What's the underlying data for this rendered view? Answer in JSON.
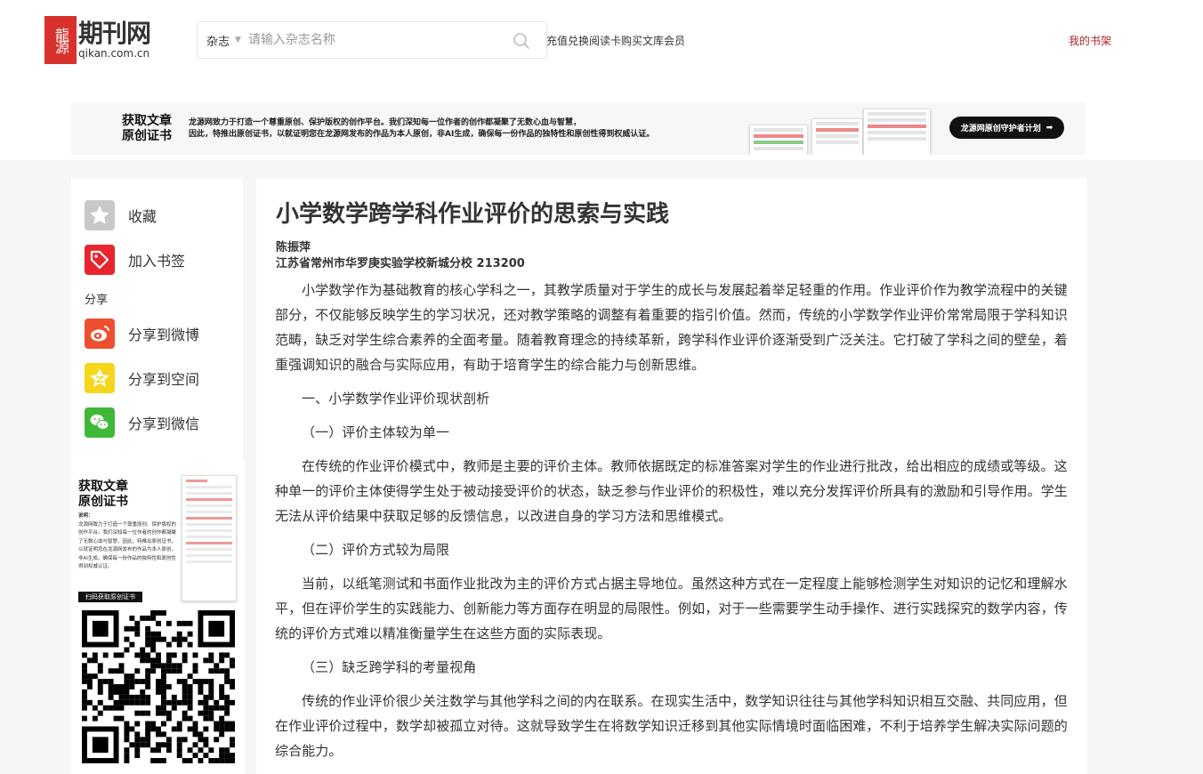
{
  "header": {
    "logo_cn": "期刊网",
    "logo_en": "qikan.com.cn",
    "logo_mark": "龍源",
    "search_type": "杂志",
    "search_placeholder": "请输入杂志名称",
    "top_link": "充值兑换阅读卡购买文库会员",
    "bookshelf": "我的书架"
  },
  "banner": {
    "title_line1": "获取文章",
    "title_line2": "原创证书",
    "desc_line1": "龙源网致力于打造一个尊重原创、保护版权的创作平台。我们深知每一位作者的创作都凝聚了无数心血与智慧，",
    "desc_line2": "因此，特推出原创证书，以就证明您在龙源网发布的作品为本人原创，非AI生成，确保每一份作品的独特性和原创性得到权威认证。",
    "button": "龙源网原创守护者计划"
  },
  "sidebar": {
    "favorite": "收藏",
    "bookmark": "加入书签",
    "share_title": "分享",
    "share_weibo": "分享到微博",
    "share_qzone": "分享到空间",
    "share_wechat": "分享到微信",
    "promo_title_line1": "获取文章",
    "promo_title_line2": "原创证书",
    "promo_desc_label": "说明：",
    "promo_desc": "龙源网致力于打造一个尊重原创、保护版权的创作平台。我们深知每一位作者的创作都凝聚了无数心血与智慧，因此，特推出原创证书，以就证明您在龙源网发布的作品为本人原创，非AI生成，确保每一份作品的独特性和原创性得到权威认证。",
    "promo_cta": "扫码获取原创证书"
  },
  "article": {
    "title": "小学数学跨学科作业评价的思索与实践",
    "author": "陈振萍",
    "org": "江苏省常州市华罗庚实验学校新城分校 213200",
    "paragraphs": [
      "小学数学作为基础教育的核心学科之一，其教学质量对于学生的成长与发展起着举足轻重的作用。作业评价作为教学流程中的关键部分，不仅能够反映学生的学习状况，还对教学策略的调整有着重要的指引价值。然而，传统的小学数学作业评价常常局限于学科知识范畴，缺乏对学生综合素养的全面考量。随着教育理念的持续革新，跨学科作业评价逐渐受到广泛关注。它打破了学科之间的壁垒，着重强调知识的融合与实际应用，有助于培育学生的综合能力与创新思维。",
      "一、小学数学作业评价现状剖析",
      "（一）评价主体较为单一",
      "在传统的作业评价模式中，教师是主要的评价主体。教师依据既定的标准答案对学生的作业进行批改，给出相应的成绩或等级。这种单一的评价主体使得学生处于被动接受评价的状态，缺乏参与作业评价的积极性，难以充分发挥评价所具有的激励和引导作用。学生无法从评价结果中获取足够的反馈信息，以改进自身的学习方法和思维模式。",
      "（二）评价方式较为局限",
      "当前，以纸笔测试和书面作业批改为主的评价方式占据主导地位。虽然这种方式在一定程度上能够检测学生对知识的记忆和理解水平，但在评价学生的实践能力、创新能力等方面存在明显的局限性。例如，对于一些需要学生动手操作、进行实践探究的数学内容，传统的评价方式难以精准衡量学生在这些方面的实际表现。",
      "（三）缺乏跨学科的考量视角",
      "传统的作业评价很少关注数学与其他学科之间的内在联系。在现实生活中，数学知识往往与其他学科知识相互交融、共同应用，但在作业评价过程中，数学却被孤立对待。这就导致学生在将数学知识迁移到其他实际情境时面临困难，不利于培养学生解决实际问题的综合能力。"
    ]
  }
}
